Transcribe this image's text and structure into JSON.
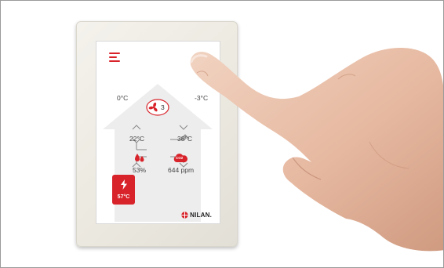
{
  "display": {
    "outdoor_temp": "0°C",
    "exhaust_temp": "-3°C",
    "supply_temp": "22°C",
    "extract_temp": "38°C",
    "fan_level": "3",
    "humidity": "53%",
    "co2_badge": "CO2",
    "co2_value": "644 ppm",
    "water_temp": "57°C",
    "brand": "NILAN."
  },
  "colors": {
    "accent": "#d8232a",
    "house": "#ededed",
    "text": "#444444"
  },
  "icons": [
    "menu-icon",
    "fan-icon",
    "humidity-drops-icon",
    "co2-cloud-icon",
    "lightning-icon",
    "nilan-logo-icon"
  ]
}
